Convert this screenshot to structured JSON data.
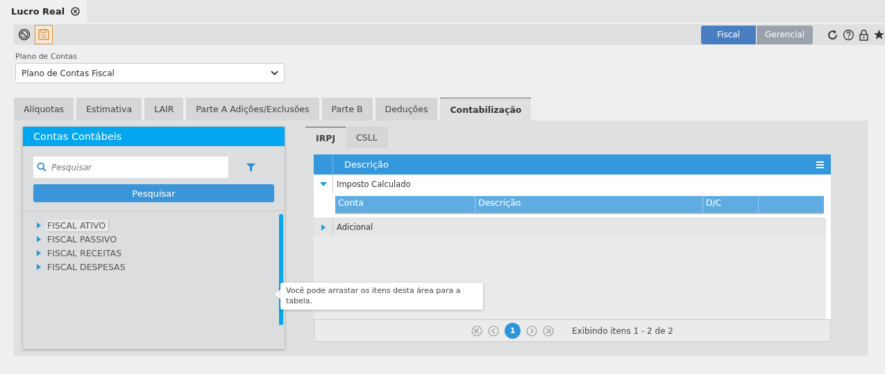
{
  "document_tab": {
    "title": "Lucro Real"
  },
  "toolbar": {
    "toggles": [
      {
        "label": "Fiscal",
        "selected": true
      },
      {
        "label": "Gerencial",
        "selected": false
      }
    ]
  },
  "plano_de_contas": {
    "label": "Plano de Contas",
    "value": "Plano de Contas Fiscal"
  },
  "tabs": [
    {
      "label": "Alíquotas",
      "selected": false
    },
    {
      "label": "Estimativa",
      "selected": false
    },
    {
      "label": "LAIR",
      "selected": false
    },
    {
      "label": "Parte A Adições/Exclusões",
      "selected": false
    },
    {
      "label": "Parte B",
      "selected": false
    },
    {
      "label": "Deduções",
      "selected": false
    },
    {
      "label": "Contabilização",
      "selected": true
    }
  ],
  "contas_panel": {
    "title": "Contas Contábeis",
    "search": {
      "placeholder": "Pesquisar"
    },
    "search_button": "Pesquisar",
    "tree": [
      {
        "label": "FISCAL ATIVO",
        "expanded": false,
        "hovered": true
      },
      {
        "label": "FISCAL PASSIVO",
        "expanded": false,
        "hovered": false
      },
      {
        "label": "FISCAL RECEITAS",
        "expanded": false,
        "hovered": false
      },
      {
        "label": "FISCAL DESPESAS",
        "expanded": false,
        "hovered": false
      }
    ]
  },
  "tooltip": "Você pode arrastar os itens desta área para a tabela.",
  "sub_tabs": [
    {
      "label": "IRPJ",
      "selected": true
    },
    {
      "label": "CSLL",
      "selected": false
    }
  ],
  "grid": {
    "column": "Descrição",
    "rows": [
      {
        "label": "Imposto Calculado",
        "expanded": true,
        "columns": [
          "Conta",
          "Descrição",
          "D/C"
        ]
      },
      {
        "label": "Adicional",
        "expanded": false
      }
    ]
  },
  "pager": {
    "page": "1",
    "info": "Exibindo itens 1 - 2 de 2"
  }
}
